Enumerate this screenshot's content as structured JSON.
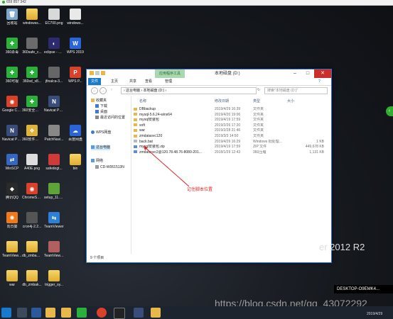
{
  "remote_bar": {
    "connection_id": "659 857 342"
  },
  "desktop": {
    "icons": [
      {
        "label": "回收站",
        "color": "#7fa7c9",
        "glyph": "🗑"
      },
      {
        "label": "windowss...",
        "color": "folder",
        "glyph": ""
      },
      {
        "label": "EC700.png",
        "color": "#d9d9d9",
        "glyph": ""
      },
      {
        "label": "windows...",
        "color": "#e9e9e9",
        "glyph": ""
      },
      {
        "label": "360杀毒",
        "color": "#2bb13b",
        "glyph": "✚"
      },
      {
        "label": "360safe_c...",
        "color": "#6b6b6b",
        "glyph": ""
      },
      {
        "label": "eclipse - 快捷方式",
        "color": "#2d2a6e",
        "glyph": "◐"
      },
      {
        "label": "WPS 2019",
        "color": "#2a64d9",
        "glyph": "W"
      },
      {
        "label": "360可视",
        "color": "#2bb13b",
        "glyph": "✚"
      },
      {
        "label": "360sd_x8...",
        "color": "#2bb13b",
        "glyph": "✚"
      },
      {
        "label": "jfinalca-3...",
        "color": "#666",
        "glyph": ""
      },
      {
        "label": "WPS P...",
        "color": "#d9412b",
        "glyph": "P"
      },
      {
        "label": "Google Chrome",
        "color": "#d9412b",
        "glyph": "◉"
      },
      {
        "label": "360安全卫士",
        "color": "#2bb13b",
        "glyph": "✚"
      },
      {
        "label": "Navicat Premiu...",
        "color": "#3a4d7a",
        "glyph": "N"
      },
      {
        "label": "",
        "color": "#333",
        "glyph": ""
      },
      {
        "label": "Navicat Premium",
        "color": "#3a4d7a",
        "glyph": "N"
      },
      {
        "label": "360软件管家",
        "color": "#e0b43b",
        "glyph": "❖"
      },
      {
        "label": "PatchNavi...",
        "color": "#888",
        "glyph": ""
      },
      {
        "label": "百度网盘",
        "color": "#2a64d9",
        "glyph": "☁"
      },
      {
        "label": "WinSCP",
        "color": "#3466c2",
        "glyph": "⇄"
      },
      {
        "label": "A40E.png",
        "color": "#ddd",
        "glyph": ""
      },
      {
        "label": "safedogt...",
        "color": "#d03a3a",
        "glyph": ""
      },
      {
        "label": "bin",
        "color": "folder",
        "glyph": ""
      },
      {
        "label": "腾讯QQ",
        "color": "#2a2a2a",
        "glyph": "◆"
      },
      {
        "label": "ChromeSe...",
        "color": "#d9412b",
        "glyph": "◉"
      },
      {
        "label": "setup_11.3...",
        "color": "#5ea43a",
        "glyph": ""
      },
      {
        "label": "",
        "color": "#333",
        "glyph": ""
      },
      {
        "label": "向日葵",
        "color": "#f07a1a",
        "glyph": "✺"
      },
      {
        "label": "cron4j-2.2...",
        "color": "#555",
        "glyph": ""
      },
      {
        "label": "TeamViewer",
        "color": "#2d7fd8",
        "glyph": "⇆"
      },
      {
        "label": "",
        "color": "#333",
        "glyph": ""
      },
      {
        "label": "TeamView... 破解版",
        "color": "folder",
        "glyph": ""
      },
      {
        "label": "db_zmbak... 破解版",
        "color": "folder",
        "glyph": ""
      },
      {
        "label": "TeamView... 破解版.rar",
        "color": "#b06060",
        "glyph": ""
      },
      {
        "label": "",
        "color": "#333",
        "glyph": ""
      },
      {
        "label": "war",
        "color": "folder",
        "glyph": ""
      },
      {
        "label": "db_zmbak...",
        "color": "folder",
        "glyph": ""
      },
      {
        "label": "trigger_sy...",
        "color": "folder",
        "glyph": ""
      },
      {
        "label": "",
        "color": "#333",
        "glyph": ""
      }
    ]
  },
  "window": {
    "title": "本地磁盘 (D:)",
    "context_tab": "应用程序工具",
    "ribbon_tabs": {
      "file": "文件",
      "home": "主页",
      "share": "共享",
      "view": "查看",
      "manage": "管理"
    },
    "address": "› 这台电脑 › 本地磁盘 (D:) ›",
    "search_placeholder": "搜索\"本地磁盘 (D:)\"",
    "nav": {
      "favorites": "收藏夹",
      "downloads": "下载",
      "desktop": "桌面",
      "recent": "最近访问的位置",
      "wps": "WPS网盘",
      "thispc": "这台电脑",
      "network": "网络",
      "cd": "CD-W061513N"
    },
    "headers": {
      "name": "名称",
      "date": "修改日期",
      "type": "类型",
      "size": "大小"
    },
    "files": [
      {
        "name": "DBbackup",
        "date": "2019/4/29 16:39",
        "type": "文件夹",
        "size": "",
        "kind": "folder"
      },
      {
        "name": "mysql-5.6.24-winx64",
        "date": "2019/4/20 19:06",
        "type": "文件夹",
        "size": "",
        "kind": "folder"
      },
      {
        "name": "mysql安装包",
        "date": "2019/4/19 17:59",
        "type": "文件夹",
        "size": "",
        "kind": "folder"
      },
      {
        "name": "soft",
        "date": "2019/2/26 17:20",
        "type": "文件夹",
        "size": "",
        "kind": "folder"
      },
      {
        "name": "war",
        "date": "2019/2/28 21:46",
        "type": "文件夹",
        "size": "",
        "kind": "folder"
      },
      {
        "name": "zmdatasvc120",
        "date": "2019/3/3 14:50",
        "type": "文件夹",
        "size": "",
        "kind": "folder"
      },
      {
        "name": "back.bat",
        "date": "2019/4/29 16:29",
        "type": "Windows 批处理...",
        "size": "1 KB",
        "kind": "bat"
      },
      {
        "name": "mysql安装包.zip",
        "date": "2019/4/19 17:59",
        "type": "ZIP 文件",
        "size": "449,678 KB",
        "kind": "zip"
      },
      {
        "name": "zmdatasvc2@120.78.48.76-8080-201...",
        "date": "2018/1/29 12:43",
        "type": "360压缩",
        "size": "1,131 KB",
        "kind": "zip"
      }
    ],
    "status": "9 个项目"
  },
  "annotation": "记住脚本位置",
  "os_brand": "er 2012 R2",
  "machine_label": "DESKTOP-O9EMK4...",
  "watermark": "https://blog.csdn.net/qq_43072292",
  "clock_date": "2019/4/29",
  "colors": {
    "accent": "#1979ca",
    "annotation": "#e02020",
    "context_tab": "#a9d8b0",
    "close": "#c9302c"
  }
}
